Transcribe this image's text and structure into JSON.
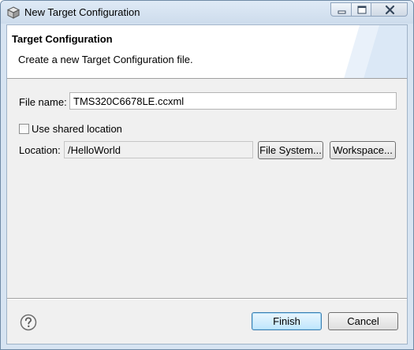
{
  "window": {
    "title": "New Target Configuration"
  },
  "banner": {
    "title": "Target Configuration",
    "description": "Create a new Target Configuration file."
  },
  "form": {
    "file_name_label": "File name:",
    "file_name_value": "TMS320C6678LE.ccxml",
    "shared_location_label": "Use shared location",
    "shared_location_checked": false,
    "location_label": "Location:",
    "location_value": "/HelloWorld",
    "file_system_button": "File System...",
    "workspace_button": "Workspace..."
  },
  "footer": {
    "finish_button": "Finish",
    "cancel_button": "Cancel"
  },
  "icons": {
    "app": "target-config-icon",
    "help": "help-icon",
    "minimize": "minimize-icon",
    "maximize": "maximize-icon",
    "close": "close-icon"
  },
  "colors": {
    "default_button_border": "#3c7fb1",
    "titlebar": "#d7e4f2"
  }
}
